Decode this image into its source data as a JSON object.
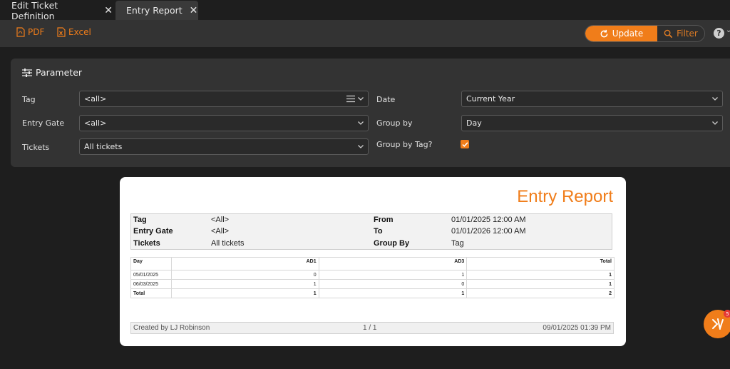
{
  "tabs": [
    {
      "label": "Edit Ticket Definition"
    },
    {
      "label": "Entry Report"
    }
  ],
  "toolbar": {
    "pdf_label": "PDF",
    "excel_label": "Excel",
    "update_label": "Update",
    "filter_label": "Filter",
    "help_label": "?"
  },
  "panel": {
    "title": "Parameter",
    "tag": {
      "label": "Tag",
      "value": "<all>"
    },
    "entry_gate": {
      "label": "Entry Gate",
      "value": "<all>"
    },
    "tickets": {
      "label": "Tickets",
      "value": "All tickets"
    },
    "date": {
      "label": "Date",
      "value": "Current Year"
    },
    "group_by": {
      "label": "Group by",
      "value": "Day"
    },
    "group_by_tag": {
      "label": "Group by Tag?",
      "checked": true
    }
  },
  "report": {
    "title": "Entry Report",
    "header": {
      "tag_key": "Tag",
      "tag_val": "<All>",
      "gate_key": "Entry Gate",
      "gate_val": "<All>",
      "tickets_key": "Tickets",
      "tickets_val": "All tickets",
      "from_key": "From",
      "from_val": "01/01/2025 12:00 AM",
      "to_key": "To",
      "to_val": "01/01/2026 12:00 AM",
      "groupby_key": "Group By",
      "groupby_val": "Tag"
    },
    "table": {
      "columns": [
        "Day",
        "AD1",
        "AD3",
        "Total"
      ],
      "rows": [
        [
          "05/01/2025",
          "0",
          "1",
          "1"
        ],
        [
          "06/03/2025",
          "1",
          "0",
          "1"
        ],
        [
          "Total",
          "1",
          "1",
          "2"
        ]
      ]
    },
    "footer": {
      "created_by": "Created by LJ Robinson",
      "page": "1  /  1",
      "timestamp": "09/01/2025 01:39 PM"
    }
  },
  "fab": {
    "badge": "5"
  },
  "colors": {
    "accent": "#f07d1a",
    "background": "#1e1e1e",
    "panel": "#333333"
  }
}
